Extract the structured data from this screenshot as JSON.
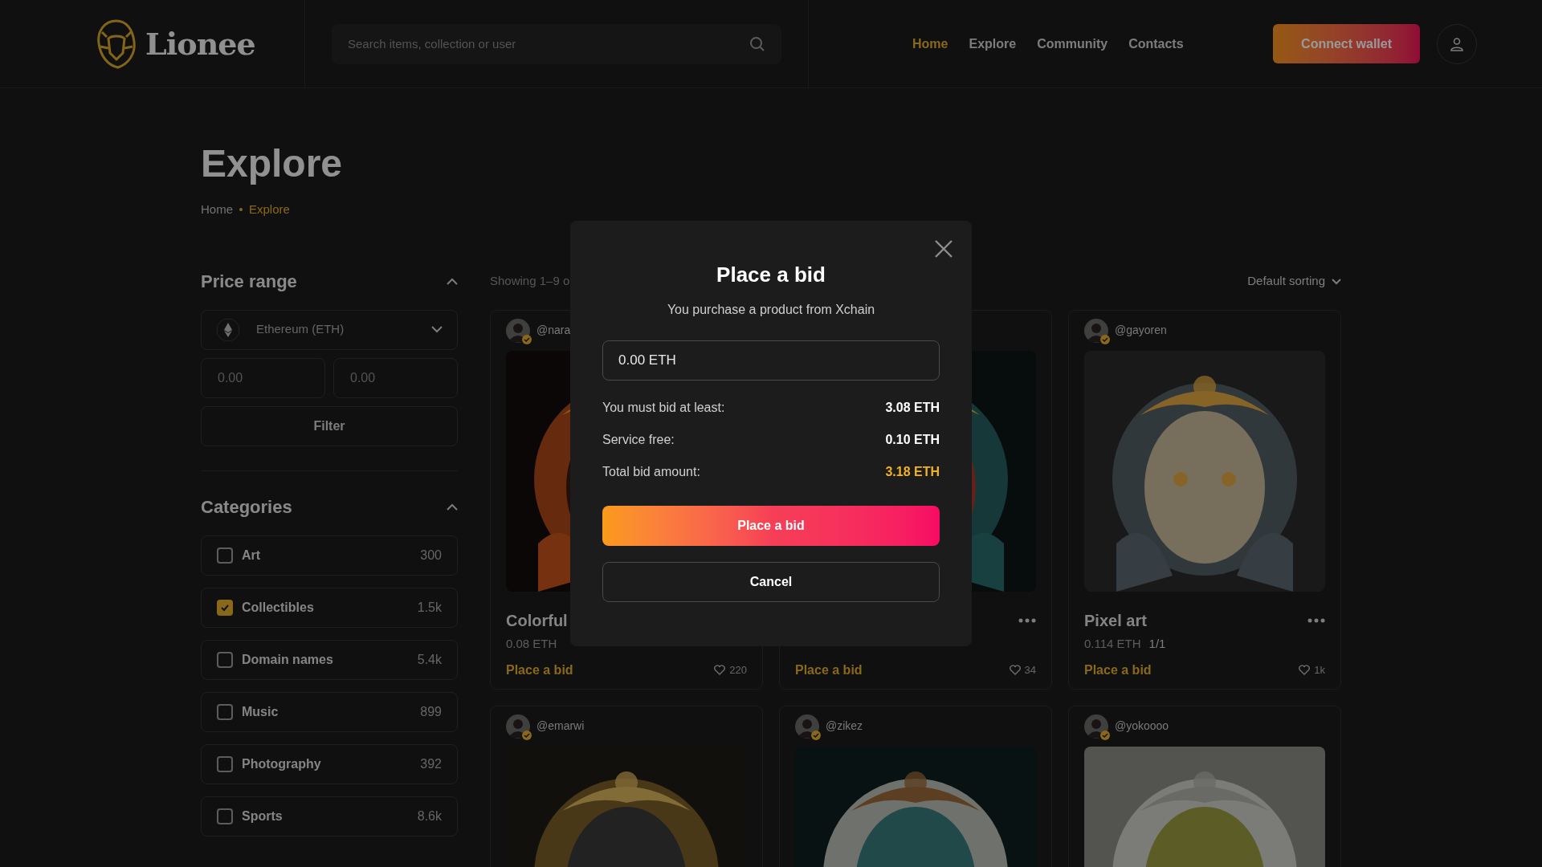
{
  "header": {
    "logo": "Lionee",
    "search": {
      "placeholder": "Search items, collection or user"
    },
    "nav": [
      {
        "label": "Home",
        "selected": true
      },
      {
        "label": "Explore",
        "selected": false
      },
      {
        "label": "Community",
        "selected": false
      },
      {
        "label": "Contacts",
        "selected": false
      }
    ],
    "connect_button": "Connect wallet"
  },
  "page": {
    "title": "Explore",
    "breadcrumb": [
      {
        "label": "Home",
        "selected": false
      },
      {
        "label": "Explore",
        "selected": true
      }
    ]
  },
  "price_range": {
    "title": "Price range",
    "expanded": true,
    "currency": "Ethereum (ETH)",
    "min": {
      "placeholder": "0.00"
    },
    "max": {
      "placeholder": "0.00"
    },
    "filter_button": "Filter"
  },
  "categories": {
    "title": "Categories",
    "expanded": true,
    "items": [
      {
        "label": "Art",
        "count": "300",
        "checked": false
      },
      {
        "label": "Collectibles",
        "count": "1.5k",
        "checked": true
      },
      {
        "label": "Domain names",
        "count": "5.4k",
        "checked": false
      },
      {
        "label": "Music",
        "count": "899",
        "checked": false
      },
      {
        "label": "Photography",
        "count": "392",
        "checked": false
      },
      {
        "label": "Sports",
        "count": "8.6k",
        "checked": false
      }
    ]
  },
  "results": {
    "showing": "Showing 1–9 o",
    "sorting": "Default sorting"
  },
  "cards": [
    {
      "username": "@nara",
      "title": "Colorful",
      "price": "0.08 ETH",
      "action": "Place a bid",
      "likes": "220"
    },
    {
      "action": "Place a bid",
      "likes": "34",
      "has_menu": true
    },
    {
      "username": "@gayoren",
      "title": "Pixel art",
      "price": "0.114 ETH",
      "edition": "1/1",
      "action": "Place a bid",
      "likes": "1k",
      "has_menu": true
    },
    {
      "username": "@emarwi"
    },
    {
      "username": "@zikez"
    },
    {
      "username": "@yokoooo"
    }
  ],
  "modal": {
    "title": "Place a bid",
    "subtitle": "You purchase a product from Xchain",
    "amount": {
      "value": "0.00 ETH"
    },
    "rows": [
      {
        "label": "You must bid at least:",
        "value": "3.08 ETH",
        "highlight": false
      },
      {
        "label": "Service free:",
        "value": "0.10 ETH",
        "highlight": false
      },
      {
        "label": "Total bid amount:",
        "value": "3.18 ETH",
        "highlight": true
      }
    ],
    "confirm_button": "Place a bid",
    "cancel_button": "Cancel"
  }
}
